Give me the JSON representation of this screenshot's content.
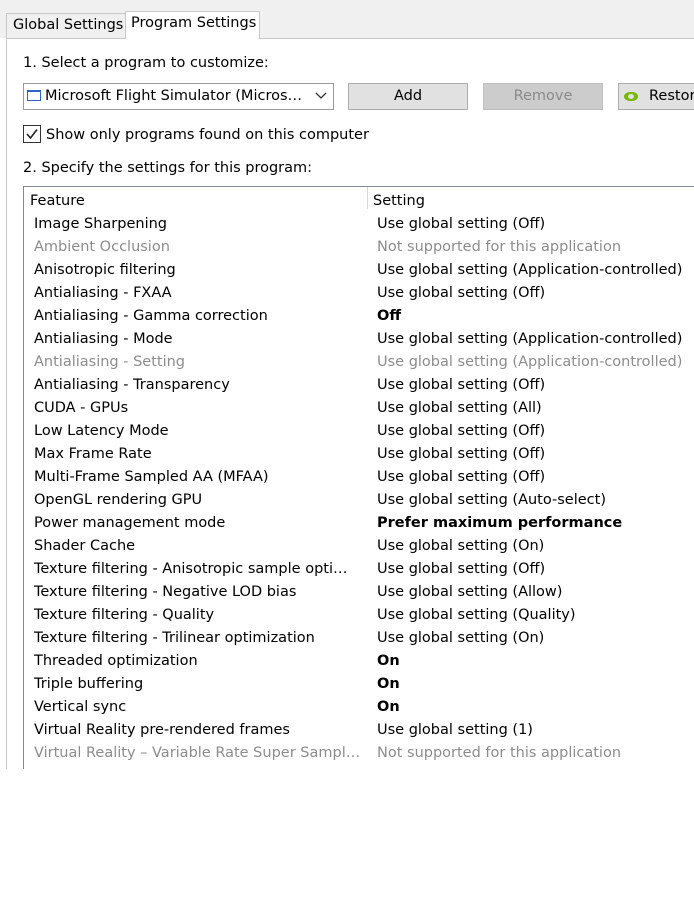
{
  "tabs": [
    "Global Settings",
    "Program Settings"
  ],
  "step1_label": "1. Select a program to customize:",
  "program_select": {
    "value": "Microsoft Flight Simulator (Micros…"
  },
  "buttons": {
    "add": "Add",
    "remove": "Remove",
    "restore": "Restore"
  },
  "show_only_checkbox": {
    "label": "Show only programs found on this computer",
    "checked": true
  },
  "step2_label": "2. Specify the settings for this program:",
  "table": {
    "headers": [
      "Feature",
      "Setting"
    ],
    "rows": [
      {
        "feature": "Image Sharpening",
        "setting": "Use global setting (Off)",
        "state": "normal"
      },
      {
        "feature": "Ambient Occlusion",
        "setting": "Not supported for this application",
        "state": "disabled"
      },
      {
        "feature": "Anisotropic filtering",
        "setting": "Use global setting (Application-controlled)",
        "state": "normal"
      },
      {
        "feature": "Antialiasing - FXAA",
        "setting": "Use global setting (Off)",
        "state": "normal"
      },
      {
        "feature": "Antialiasing - Gamma correction",
        "setting": "Off",
        "state": "bold"
      },
      {
        "feature": "Antialiasing - Mode",
        "setting": "Use global setting (Application-controlled)",
        "state": "normal"
      },
      {
        "feature": "Antialiasing - Setting",
        "setting": "Use global setting (Application-controlled)",
        "state": "disabled"
      },
      {
        "feature": "Antialiasing - Transparency",
        "setting": "Use global setting (Off)",
        "state": "normal"
      },
      {
        "feature": "CUDA - GPUs",
        "setting": "Use global setting (All)",
        "state": "normal"
      },
      {
        "feature": "Low Latency Mode",
        "setting": "Use global setting (Off)",
        "state": "normal"
      },
      {
        "feature": "Max Frame Rate",
        "setting": "Use global setting (Off)",
        "state": "normal"
      },
      {
        "feature": "Multi-Frame Sampled AA (MFAA)",
        "setting": "Use global setting (Off)",
        "state": "normal"
      },
      {
        "feature": "OpenGL rendering GPU",
        "setting": "Use global setting (Auto-select)",
        "state": "normal"
      },
      {
        "feature": "Power management mode",
        "setting": "Prefer maximum performance",
        "state": "bold"
      },
      {
        "feature": "Shader Cache",
        "setting": "Use global setting (On)",
        "state": "normal"
      },
      {
        "feature": "Texture filtering - Anisotropic sample opti…",
        "setting": "Use global setting (Off)",
        "state": "normal"
      },
      {
        "feature": "Texture filtering - Negative LOD bias",
        "setting": "Use global setting (Allow)",
        "state": "normal"
      },
      {
        "feature": "Texture filtering - Quality",
        "setting": "Use global setting (Quality)",
        "state": "normal"
      },
      {
        "feature": "Texture filtering - Trilinear optimization",
        "setting": "Use global setting (On)",
        "state": "normal"
      },
      {
        "feature": "Threaded optimization",
        "setting": "On",
        "state": "bold"
      },
      {
        "feature": "Triple buffering",
        "setting": "On",
        "state": "bold"
      },
      {
        "feature": "Vertical sync",
        "setting": "On",
        "state": "bold"
      },
      {
        "feature": "Virtual Reality pre-rendered frames",
        "setting": "Use global setting (1)",
        "state": "normal"
      },
      {
        "feature": "Virtual Reality – Variable Rate Super Sampli…",
        "setting": "Not supported for this application",
        "state": "disabled"
      }
    ]
  },
  "colors": {
    "disabled_text": "#8c8c8c",
    "nvidia_green": "#76b900",
    "tab_bg": "#f0f0f0"
  },
  "icons": {
    "program_icon": "window-icon",
    "restore_icon": "nvidia-logo-icon",
    "dropdown_icon": "chevron-down-icon",
    "checkbox_icon": "checkmark-icon"
  }
}
